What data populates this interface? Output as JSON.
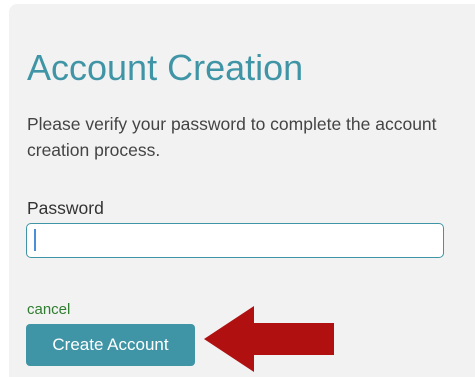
{
  "form": {
    "title": "Account Creation",
    "description": "Please verify your password to complete the account creation process.",
    "password_label": "Password",
    "password_value": "",
    "password_placeholder": "",
    "cancel_label": "cancel",
    "submit_label": "Create Account"
  },
  "annotation": {
    "arrow_color": "#b01010",
    "arrow_direction": "left",
    "points_to": "create-account-button"
  },
  "colors": {
    "accent": "#3f95a6",
    "cancel_link": "#2f7d2f",
    "panel_background": "#f2f2f2"
  }
}
